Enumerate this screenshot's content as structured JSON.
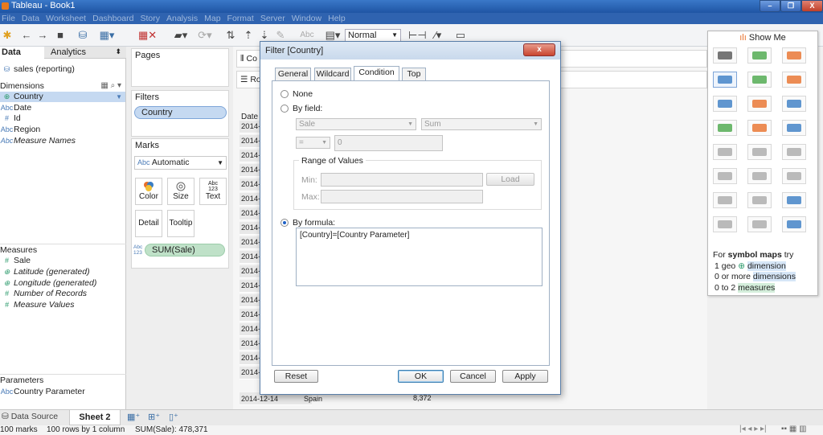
{
  "app": {
    "title": "Tableau - Book1"
  },
  "window_buttons": {
    "minimize": "–",
    "restore": "❐",
    "close": "X"
  },
  "menu": [
    "File",
    "Data",
    "Worksheet",
    "Dashboard",
    "Story",
    "Analysis",
    "Map",
    "Format",
    "Server",
    "Window",
    "Help"
  ],
  "toolbar": {
    "fit_select": "Normal",
    "text_label": "Abc"
  },
  "left_panel": {
    "tabs": [
      "Data",
      "Analytics"
    ],
    "datasource": "sales (reporting)",
    "dimensions_header": "Dimensions",
    "dimensions": [
      {
        "type": "⊕",
        "label": "Country",
        "selected": true
      },
      {
        "type": "Abc",
        "label": "Date"
      },
      {
        "type": "#",
        "label": "Id"
      },
      {
        "type": "Abc",
        "label": "Region"
      },
      {
        "type": "Abc",
        "label": "Measure Names",
        "italic": true
      }
    ],
    "measures_header": "Measures",
    "measures": [
      {
        "type": "#",
        "label": "Sale"
      },
      {
        "type": "⊕",
        "label": "Latitude (generated)",
        "italic": true
      },
      {
        "type": "⊕",
        "label": "Longitude (generated)",
        "italic": true
      },
      {
        "type": "#",
        "label": "Number of Records",
        "italic": true
      },
      {
        "type": "#",
        "label": "Measure Values",
        "italic": true
      }
    ],
    "parameters_header": "Parameters",
    "parameters": [
      {
        "type": "Abc",
        "label": "Country Parameter"
      }
    ]
  },
  "mid_panel": {
    "pages": "Pages",
    "filters": "Filters",
    "filter_pill": "Country",
    "marks": "Marks",
    "mark_type": "Automatic",
    "mark_type_icon": "Abc",
    "mark_buttons": [
      "Color",
      "Size",
      "Text",
      "Detail",
      "Tooltip"
    ],
    "text_button_glyph": "Abc\n123",
    "measure_pill": "SUM(Sale)",
    "measure_pill_icon": "Abc\n123"
  },
  "sheet": {
    "columns_label": "Co",
    "rows_label": "Ro",
    "header": "Date",
    "dates": [
      "2014-",
      "2014-",
      "2014-",
      "2014-",
      "2014-",
      "2014-",
      "2014-",
      "2014-",
      "2014-",
      "2014-",
      "2014-",
      "2014-",
      "2014-",
      "2014-",
      "2014-",
      "2014-",
      "2014-",
      "2014-"
    ],
    "last_row": "2014-12-14",
    "last_cell": "Spain",
    "last_value": "8,372"
  },
  "show_me": {
    "title": "Show Me",
    "hint_line1_prefix": "For ",
    "hint_line1_bold": "symbol maps",
    "hint_line1_suffix": " try",
    "req1_prefix": "1 geo ",
    "req1_suffix": "dimension",
    "req2_prefix": "0 or more ",
    "req2_suffix": "dimensions",
    "req3_prefix": "0 to 2 ",
    "req3_suffix": "measures"
  },
  "bottom": {
    "datasource_tab": "Data Source",
    "sheet_tab": "Sheet 2"
  },
  "status": {
    "marks": "100 marks",
    "rows": "100 rows by 1 column",
    "sum": "SUM(Sale): 478,371"
  },
  "dialog": {
    "title": "Filter [Country]",
    "close": "x",
    "tabs": [
      "General",
      "Wildcard",
      "Condition",
      "Top"
    ],
    "active_tab": "Condition",
    "none_label": "None",
    "by_field_label": "By field:",
    "field_select": "Sale",
    "agg_select": "Sum",
    "op_select": "=",
    "value_input": "0",
    "range_label": "Range of Values",
    "min_label": "Min:",
    "max_label": "Max:",
    "load_button": "Load",
    "by_formula_label": "By formula:",
    "formula": "[Country]=[Country Parameter]",
    "reset": "Reset",
    "ok": "OK",
    "cancel": "Cancel",
    "apply": "Apply"
  }
}
